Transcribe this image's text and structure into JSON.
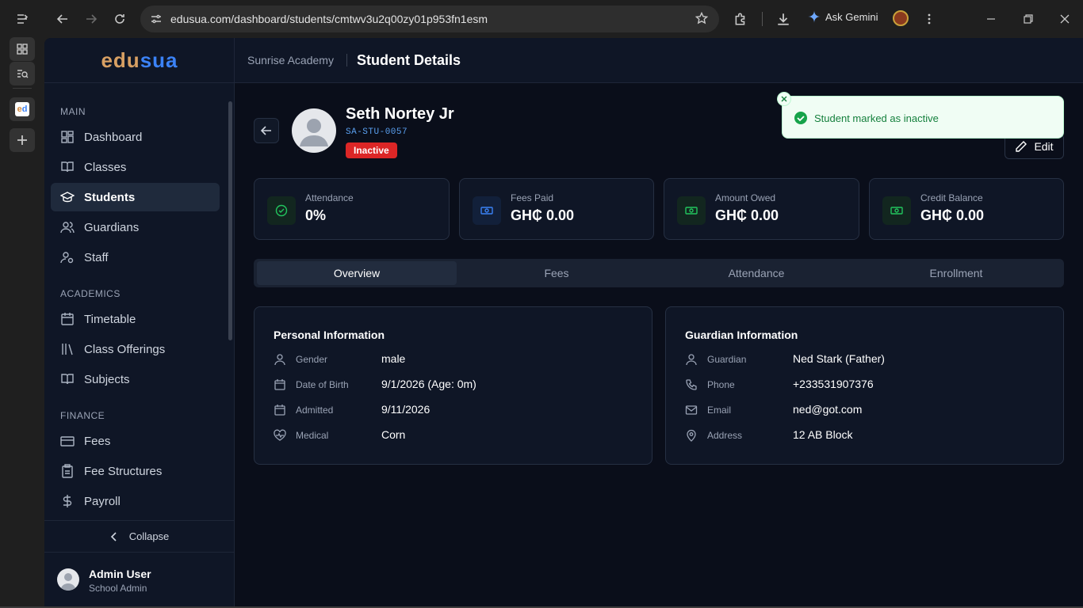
{
  "browser": {
    "url": "edusua.com/dashboard/students/cmtwv3u2q00zy01p953fn1esm",
    "ask_gemini": "Ask Gemini",
    "tab_favicon_text_a": "e",
    "tab_favicon_text_b": "d"
  },
  "logo": {
    "part1": "edu",
    "part2": "sua"
  },
  "sidebar": {
    "sections": [
      {
        "label": "MAIN"
      },
      {
        "label": "ACADEMICS"
      },
      {
        "label": "FINANCE"
      }
    ],
    "items": [
      {
        "label": "Dashboard",
        "icon": "dashboard-icon"
      },
      {
        "label": "Classes",
        "icon": "book-icon"
      },
      {
        "label": "Students",
        "icon": "graduation-cap-icon",
        "active": true
      },
      {
        "label": "Guardians",
        "icon": "users-icon"
      },
      {
        "label": "Staff",
        "icon": "user-cog-icon"
      },
      {
        "label": "Timetable",
        "icon": "calendar-icon"
      },
      {
        "label": "Class Offerings",
        "icon": "library-icon"
      },
      {
        "label": "Subjects",
        "icon": "book-open-icon"
      },
      {
        "label": "Fees",
        "icon": "card-icon"
      },
      {
        "label": "Fee Structures",
        "icon": "clipboard-icon"
      },
      {
        "label": "Payroll",
        "icon": "dollar-icon"
      }
    ],
    "collapse_label": "Collapse",
    "user": {
      "name": "Admin User",
      "role": "School Admin"
    }
  },
  "header": {
    "school": "Sunrise Academy",
    "title": "Student Details"
  },
  "student": {
    "name": "Seth Nortey Jr",
    "id": "SA-STU-0057",
    "status": "Inactive",
    "edit_label": "Edit"
  },
  "stats": [
    {
      "label": "Attendance",
      "value": "0%",
      "icon": "check-circle-icon",
      "color": "#22c55e"
    },
    {
      "label": "Fees Paid",
      "value": "GH₵ 0.00",
      "icon": "banknote-icon",
      "color": "#3b82f6"
    },
    {
      "label": "Amount Owed",
      "value": "GH₵ 0.00",
      "icon": "banknote-icon",
      "color": "#22c55e"
    },
    {
      "label": "Credit Balance",
      "value": "GH₵ 0.00",
      "icon": "banknote-icon",
      "color": "#22c55e"
    }
  ],
  "tabs": [
    "Overview",
    "Fees",
    "Attendance",
    "Enrollment"
  ],
  "personal": {
    "title": "Personal Information",
    "rows": [
      {
        "label": "Gender",
        "value": "male"
      },
      {
        "label": "Date of Birth",
        "value": "9/1/2026 (Age: 0m)"
      },
      {
        "label": "Admitted",
        "value": "9/11/2026"
      },
      {
        "label": "Medical",
        "value": "Corn"
      }
    ]
  },
  "guardian": {
    "title": "Guardian Information",
    "rows": [
      {
        "label": "Guardian",
        "value": "Ned Stark (Father)"
      },
      {
        "label": "Phone",
        "value": "+233531907376"
      },
      {
        "label": "Email",
        "value": "ned@got.com"
      },
      {
        "label": "Address",
        "value": "12 AB Block"
      }
    ]
  },
  "toast": {
    "message": "Student marked as inactive"
  }
}
